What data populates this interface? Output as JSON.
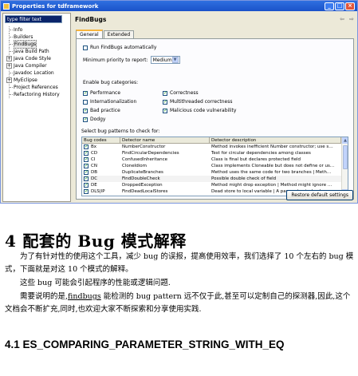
{
  "window": {
    "title": "Properties for tdframework",
    "controls": [
      "_",
      "□",
      "×"
    ]
  },
  "sidebar": {
    "filter_text": "type filter text",
    "items": [
      {
        "label": "Info",
        "expandable": false
      },
      {
        "label": "Builders",
        "expandable": false
      },
      {
        "label": "FindBugs",
        "expandable": false,
        "selected": true
      },
      {
        "label": "Java Build Path",
        "expandable": false
      },
      {
        "label": "Java Code Style",
        "expandable": true
      },
      {
        "label": "Java Compiler",
        "expandable": true
      },
      {
        "label": "Javadoc Location",
        "expandable": false
      },
      {
        "label": "MyEclipse",
        "expandable": true
      },
      {
        "label": "Project References",
        "expandable": false
      },
      {
        "label": "Refactoring History",
        "expandable": false
      }
    ]
  },
  "page": {
    "title": "FindBugs",
    "nav_back": "⇦",
    "nav_forward": "⇨",
    "tabs": [
      {
        "label": "General",
        "active": true
      },
      {
        "label": "Extended",
        "active": false
      }
    ],
    "run_auto_label": "Run FindBugs automatically",
    "priority_label": "Minimum priority to report:",
    "priority_value": "Medium",
    "categories_label": "Enable bug categories:",
    "categories": [
      {
        "label": "Performance",
        "checked": true
      },
      {
        "label": "Correctness",
        "checked": true
      },
      {
        "label": "Internationalization",
        "checked": false
      },
      {
        "label": "Multithreaded correctness",
        "checked": true
      },
      {
        "label": "Bad practice",
        "checked": true
      },
      {
        "label": "Malicious code vulnerability",
        "checked": true
      },
      {
        "label": "Dodgy",
        "checked": true
      }
    ],
    "patterns_label": "Select bug patterns to check for:",
    "table_headers": [
      "Bug codes",
      "Detector name",
      "Detector description"
    ],
    "table_rows": [
      {
        "code": "Bx",
        "name": "NumberConstructor",
        "desc": "Method invokes inefficient Number constructor; use s…",
        "checked": true
      },
      {
        "code": "CD",
        "name": "FindCircularDependencies",
        "desc": "Test for circular dependencies among classes",
        "checked": true
      },
      {
        "code": "CI",
        "name": "ConfusedInheritance",
        "desc": "Class is final but declares protected field",
        "checked": true
      },
      {
        "code": "CN",
        "name": "CloneIdiom",
        "desc": "Class implements Cloneable but does not define or us…",
        "checked": true
      },
      {
        "code": "DB",
        "name": "DuplicateBranches",
        "desc": "Method uses the same code for two branches | Meth…",
        "checked": true
      },
      {
        "code": "DC",
        "name": "FindDoubleCheck",
        "desc": "Possible double check of field",
        "checked": true
      },
      {
        "code": "DE",
        "name": "DroppedException",
        "desc": "Method might drop exception | Method might ignore …",
        "checked": true
      },
      {
        "code": "DLS|IP",
        "name": "FindDeadLocalStores",
        "desc": "Dead store to local variable | A parameter is dead up…",
        "checked": true
      }
    ],
    "restore_label": "Restore default settings"
  },
  "doc": {
    "section_number": "4",
    "section_title": "配套的 Bug 模式解释",
    "para1": "为了有针对性的使用这个工具，减少 bug 的误报，提高使用效率，我们选择了 10 个左右的 bug 模式，下面就是对这 10 个模式的解释。",
    "para2": "这些 bug 可能会引起程序的性能或逻辑问题.",
    "para3_prefix": "需要说明的是,",
    "para3_link": "findbugs",
    "para3_suffix": " 能检测的 bug pattern 远不仅于此,甚至可以定制自己的探测器,因此,这个文档会不断扩充,同时,也欢迎大家不断探索和分享使用实践.",
    "subsection": "4.1 ES_COMPARING_PARAMETER_STRING_WITH_EQ"
  }
}
